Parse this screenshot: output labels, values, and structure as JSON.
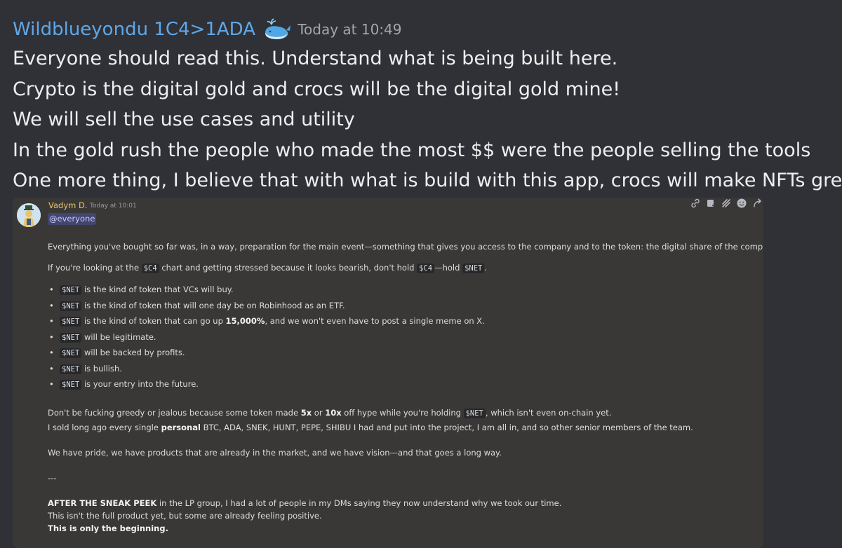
{
  "message": {
    "author": "Wildblueyondu 1C4>1ADA",
    "author_icon": "whale-icon",
    "timestamp": "Today at 10:49",
    "lines": [
      "Everyone should read this. Understand what is being built here.",
      "Crypto is the digital gold and crocs will be the digital gold mine!",
      "We will sell the use cases and utility",
      "In the gold rush the people who made the most $$ were the people selling the tools",
      "One more thing, I believe that with what is build with this app, crocs will make NFTs great a"
    ]
  },
  "embed": {
    "author": "Vadym D.",
    "timestamp": "Today at 10:01",
    "mention": "@everyone",
    "toolbar_icons": [
      "link-icon",
      "forward-icon",
      "signal-icon",
      "emoji-icon",
      "reply-icon"
    ],
    "p1": "Everything you've bought so far was, in a way, preparation for the main event—something that gives you access to the company and to the token: the digital share of the company.",
    "p2": {
      "a": "If you're looking at the ",
      "code1": "$C4",
      "b": " chart and getting stressed because it looks bearish, don't hold ",
      "code2": "$C4",
      "c": "—hold ",
      "code3": "$NET",
      "d": "."
    },
    "bullet_code": "$NET",
    "bullets": [
      " is the kind of token that VCs will buy.",
      " is the kind of token that will one day be on Robinhood as an ETF.",
      " is the kind of token that can go up ",
      " will be legitimate.",
      " will be backed by profits.",
      " is bullish.",
      " is your entry into the future."
    ],
    "bullet3_bold": "15,000%",
    "bullet3_tail": ", and we won't even have to post a single meme on X.",
    "p3": {
      "a": "Don't be fucking greedy or jealous because some token made ",
      "bold1": "5x",
      "b": " or ",
      "bold2": "10x",
      "c": " off hype while you're holding ",
      "code": "$NET",
      "d": ", which isn't even on-chain yet."
    },
    "p4": {
      "a": "I sold long ago every single ",
      "bold": "personal",
      "b": " BTC, ADA, SNEK, HUNT, PEPE, SHIBU I had and put into the project, I am all in, and so other senior members of the team."
    },
    "p5": "We have pride, we have products that are already in the market, and we have vision—and that goes a long way.",
    "separator": "---",
    "p6": {
      "bold": "AFTER THE SNEAK PEEK",
      "a": " in the LP group, I had a lot of people in my DMs saying they now understand why we took our time."
    },
    "p7": "This isn't the full product yet, but some are already feeling positive.",
    "p8": "This is only the beginning."
  }
}
